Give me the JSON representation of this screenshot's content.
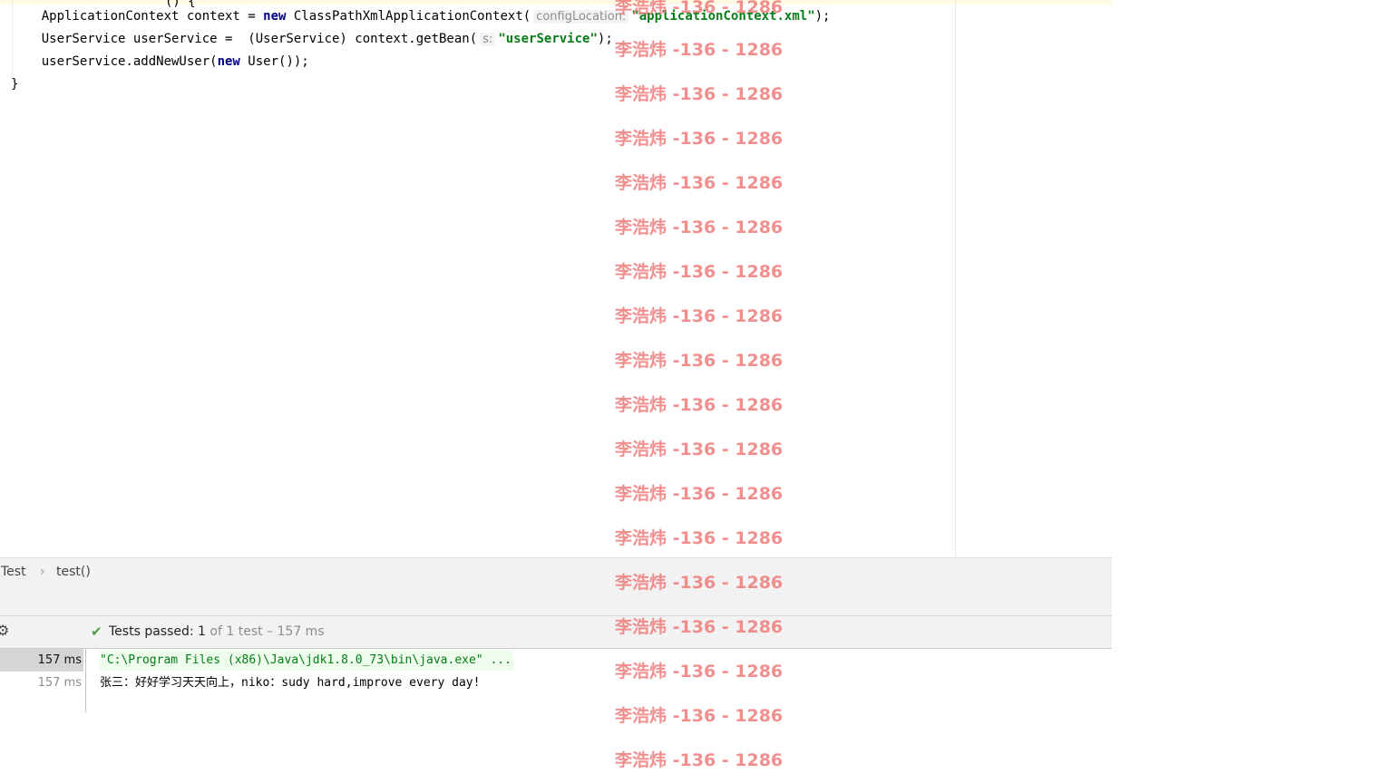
{
  "editor": {
    "caret_fragment": "() {",
    "lines": [
      {
        "p1": "    ApplicationContext context = ",
        "kw": "new",
        "p2": " ClassPathXmlApplicationContext(",
        "hint": "configLocation:",
        "str": "\"applicationContext.xml\"",
        "p3": ");"
      },
      {
        "p1": "    UserService userService =  (UserService) context.getBean(",
        "hint": "s:",
        "str": "\"userService\"",
        "p3": ");"
      },
      {
        "p1": "    userService.addNewUser(",
        "kw": "new",
        "p2": " User());"
      },
      {
        "p1": "}"
      }
    ]
  },
  "breadcrumb": {
    "items": [
      "Test",
      "test()"
    ],
    "separator": "›"
  },
  "run": {
    "gear_icon": "gear-icon",
    "check_icon": "check-icon",
    "status_label": "Tests passed:",
    "passed_count": "1",
    "status_rest": "of 1 test – 157 ms",
    "tree": [
      {
        "label": "157 ms",
        "selected": true
      },
      {
        "label": "157 ms",
        "selected": false
      }
    ],
    "console": [
      "\"C:\\Program Files (x86)\\Java\\jdk1.8.0_73\\bin\\java.exe\" ...",
      "张三：好好学习天天向上，niko：sudy hard,improve every day!"
    ]
  },
  "watermark": {
    "text": "李浩炜 -136 - 1286",
    "color": "#ef7c7c",
    "rows": 18
  },
  "colors": {
    "keyword": "#000080",
    "string": "#067d17",
    "hint": "#8c8c8c",
    "pass": "#4d9c4a"
  }
}
